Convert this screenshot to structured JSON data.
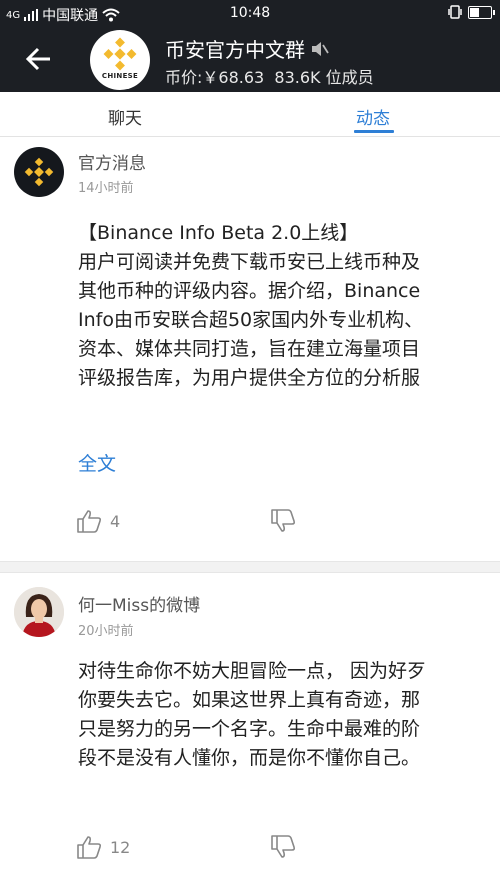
{
  "status_bar": {
    "signal": "4G",
    "carrier": "中国联通",
    "time": "10:48"
  },
  "header": {
    "group_name": "币安官方中文群",
    "muted_icon": "muted-speaker-icon",
    "avatar_caption": "CHINESE",
    "price_label": "币价:",
    "price_value": "￥68.63",
    "members": "83.6K 位成员"
  },
  "tabs": [
    {
      "label": "聊天",
      "active": false
    },
    {
      "label": "动态",
      "active": true
    }
  ],
  "accent_color": "#2e7fd6",
  "brand_color": "#f3ba2f",
  "posts": [
    {
      "author": "官方消息",
      "time": "14小时前",
      "lines": [
        "【Binance Info Beta 2.0上线】",
        "用户可阅读并免费下载币安已上线币种及",
        "其他币种的评级内容。据介绍，Binance",
        "Info由币安联合超50家国内外专业机构、",
        "资本、媒体共同打造，旨在建立海量项目",
        "评级报告库，为用户提供全方位的分析服"
      ],
      "more_label": "全文",
      "likes": "4"
    },
    {
      "author": "何一Miss的微博",
      "time": "20小时前",
      "lines": [
        "对待生命你不妨大胆冒险一点， 因为好歹",
        "你要失去它。如果这世界上真有奇迹，那",
        "只是努力的另一个名字。生命中最难的阶",
        "段不是没有人懂你，而是你不懂你自己。"
      ],
      "likes": "12"
    }
  ]
}
